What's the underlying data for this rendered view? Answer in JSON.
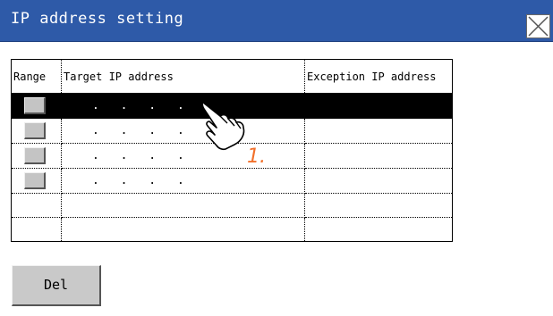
{
  "window": {
    "title": "IP address setting"
  },
  "table": {
    "headers": [
      "Range",
      "Target IP address",
      "Exception IP address"
    ],
    "rows": [
      {
        "has_checkbox": true,
        "ip": ". . . .",
        "exception": "",
        "selected": true
      },
      {
        "has_checkbox": true,
        "ip": ". . . .",
        "exception": "",
        "selected": false
      },
      {
        "has_checkbox": true,
        "ip": ". . . .",
        "exception": "",
        "selected": false
      },
      {
        "has_checkbox": true,
        "ip": ". . . .",
        "exception": "",
        "selected": false
      },
      {
        "has_checkbox": false,
        "ip": "",
        "exception": "",
        "selected": false
      },
      {
        "has_checkbox": false,
        "ip": "",
        "exception": "",
        "selected": false
      }
    ]
  },
  "buttons": {
    "delete_label": "Del"
  },
  "annotation": {
    "step_label": "1.",
    "icon": "hand-pointer-icon"
  },
  "colors": {
    "title_bar": "#2e5aa8",
    "selected_row": "#000000",
    "annotation": "#f2702a"
  }
}
